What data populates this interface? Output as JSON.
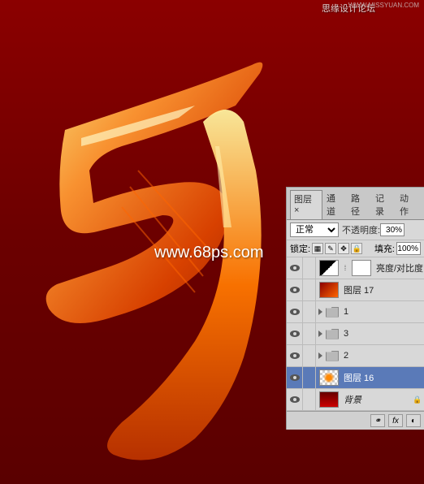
{
  "header": {
    "site_name": "思缘设计论坛",
    "site_url": "WWW.MISSYUAN.COM"
  },
  "watermark": "www.68ps.com",
  "panel": {
    "tabs": {
      "layers": "图层",
      "channels": "通道",
      "paths": "路径",
      "history": "记录",
      "actions": "动作"
    },
    "blend_mode": "正常",
    "opacity_label": "不透明度:",
    "opacity_value": "30%",
    "lock_label": "锁定:",
    "fill_label": "填充:",
    "fill_value": "100%",
    "layers": [
      {
        "type": "adjustment",
        "name": "亮度/对比度"
      },
      {
        "type": "layer",
        "name": "图层 17",
        "thumb": "fire"
      },
      {
        "type": "group",
        "name": "1"
      },
      {
        "type": "group",
        "name": "3"
      },
      {
        "type": "group",
        "name": "2"
      },
      {
        "type": "layer",
        "name": "图层 16",
        "thumb": "checker",
        "selected": true
      },
      {
        "type": "bg",
        "name": "背景",
        "thumb": "red"
      }
    ],
    "footer": {
      "fx": "fx"
    }
  }
}
